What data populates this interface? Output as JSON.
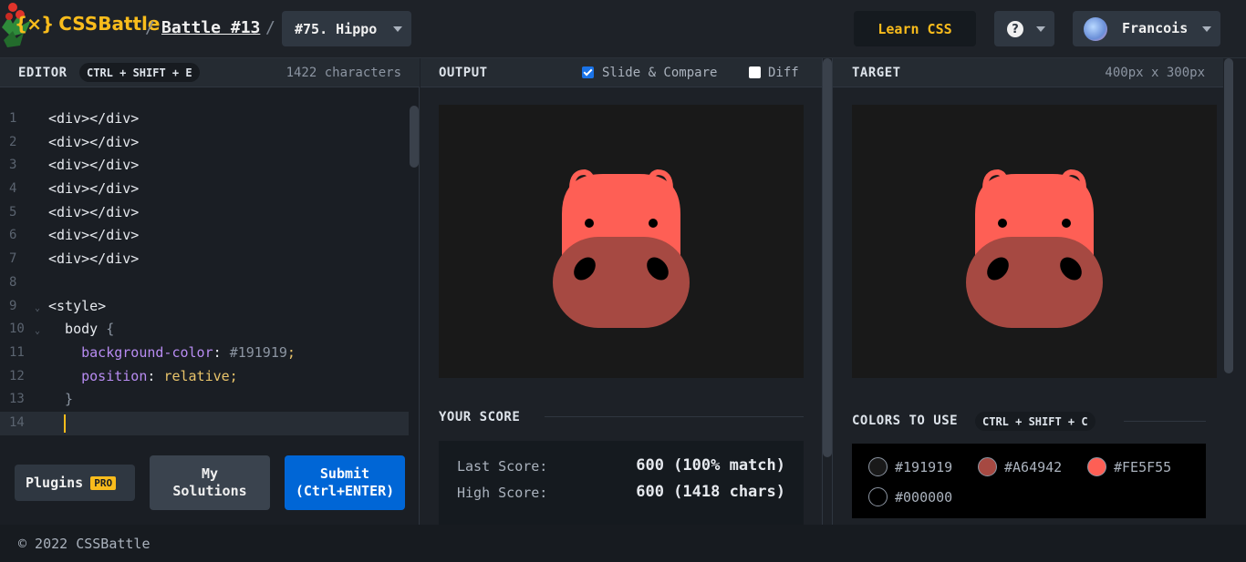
{
  "header": {
    "logo": "CSSBattle",
    "logo_mark": "{⨯}",
    "breadcrumb_battle": "Battle #13",
    "separator": "/",
    "target_select": "#75. Hippo",
    "learn_button": "Learn CSS",
    "help_glyph": "?",
    "user_name": "Francois"
  },
  "editor": {
    "title": "EDITOR",
    "shortcut": "CTRL + SHIFT + E",
    "char_count": "1422 characters",
    "lines": [
      {
        "n": "1",
        "tokens": [
          {
            "t": "tag",
            "v": "<div></div>"
          }
        ]
      },
      {
        "n": "2",
        "tokens": [
          {
            "t": "tag",
            "v": "<div></div>"
          }
        ]
      },
      {
        "n": "3",
        "tokens": [
          {
            "t": "tag",
            "v": "<div></div>"
          }
        ]
      },
      {
        "n": "4",
        "tokens": [
          {
            "t": "tag",
            "v": "<div></div>"
          }
        ]
      },
      {
        "n": "5",
        "tokens": [
          {
            "t": "tag",
            "v": "<div></div>"
          }
        ]
      },
      {
        "n": "6",
        "tokens": [
          {
            "t": "tag",
            "v": "<div></div>"
          }
        ]
      },
      {
        "n": "7",
        "tokens": [
          {
            "t": "tag",
            "v": "<div></div>"
          }
        ]
      },
      {
        "n": "8",
        "tokens": []
      },
      {
        "n": "9",
        "fold": true,
        "tokens": [
          {
            "t": "tag",
            "v": "<style>"
          }
        ]
      },
      {
        "n": "10",
        "fold": true,
        "tokens": [
          {
            "t": "tag",
            "v": "  body "
          },
          {
            "t": "hex",
            "v": "{"
          }
        ]
      },
      {
        "n": "11",
        "tokens": [
          {
            "t": "prop",
            "v": "    background-color"
          },
          {
            "t": "tag",
            "v": ": "
          },
          {
            "t": "hex",
            "v": "#191919"
          },
          {
            "t": "val",
            "v": ";"
          }
        ]
      },
      {
        "n": "12",
        "tokens": [
          {
            "t": "prop",
            "v": "    position"
          },
          {
            "t": "tag",
            "v": ": "
          },
          {
            "t": "val",
            "v": "relative;"
          }
        ]
      },
      {
        "n": "13",
        "tokens": [
          {
            "t": "hex",
            "v": "  }"
          }
        ]
      },
      {
        "n": "14",
        "active": true,
        "tokens": []
      }
    ],
    "plugins_label": "Plugins",
    "pro_badge": "PRO",
    "my_solutions_label": "My\nSolutions",
    "submit_label": "Submit\n(Ctrl+ENTER)"
  },
  "output": {
    "title": "OUTPUT",
    "slide_compare_label": "Slide & Compare",
    "slide_compare_checked": true,
    "diff_label": "Diff",
    "diff_checked": false
  },
  "score": {
    "title": "YOUR SCORE",
    "last_label": "Last Score:",
    "last_value": "600 (100% match)",
    "high_label": "High Score:",
    "high_value": "600 (1418 chars)"
  },
  "target": {
    "title": "TARGET",
    "size": "400px x 300px"
  },
  "colors": {
    "title": "COLORS TO USE",
    "shortcut": "CTRL + SHIFT + C",
    "list": [
      {
        "hex": "#191919"
      },
      {
        "hex": "#A64942"
      },
      {
        "hex": "#FE5F55"
      },
      {
        "hex": "#000000"
      }
    ]
  },
  "hippo_colors": {
    "background": "#191919",
    "head": "#FE5F55",
    "snout": "#A64942",
    "eye": "#000000"
  },
  "footer": {
    "copyright": "© 2022 CSSBattle"
  }
}
